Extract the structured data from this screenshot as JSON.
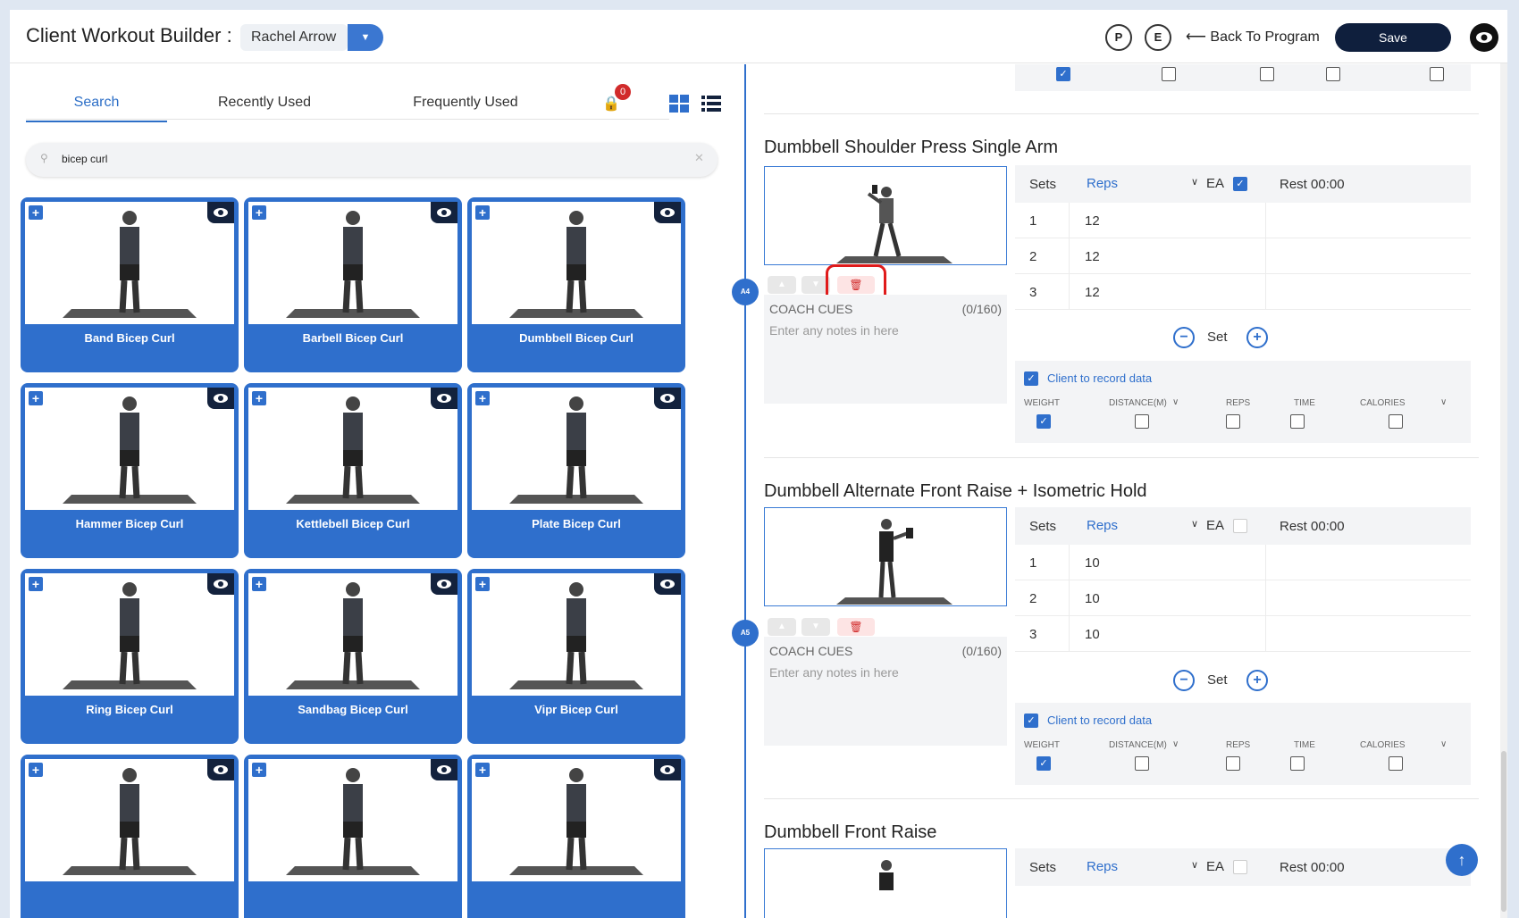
{
  "header": {
    "title": "Client Workout Builder :",
    "client_name": "Rachel Arrow",
    "p_label": "P",
    "e_label": "E",
    "back_label": "Back To Program",
    "save_label": "Save"
  },
  "tabs": {
    "search": "Search",
    "recent": "Recently Used",
    "frequent": "Frequently Used",
    "bag_count": "0"
  },
  "search": {
    "value": "bicep curl"
  },
  "cards": [
    "Band Bicep Curl",
    "Barbell Bicep Curl",
    "Dumbbell Bicep Curl",
    "Hammer Bicep Curl",
    "Kettlebell Bicep Curl",
    "Plate Bicep Curl",
    "Ring Bicep Curl",
    "Sandbag Bicep Curl",
    "Vipr Bicep Curl"
  ],
  "exercises": [
    {
      "badge": "A4",
      "title": "Dumbbell Shoulder Press Single Arm",
      "ea_checked": true,
      "rows": [
        [
          "1",
          "12"
        ],
        [
          "2",
          "12"
        ],
        [
          "3",
          "12"
        ]
      ]
    },
    {
      "badge": "A5",
      "title": "Dumbbell Alternate Front Raise + Isometric Hold",
      "ea_checked": false,
      "rows": [
        [
          "1",
          "10"
        ],
        [
          "2",
          "10"
        ],
        [
          "3",
          "10"
        ]
      ]
    },
    {
      "title": "Dumbbell Front Raise"
    }
  ],
  "table": {
    "sets": "Sets",
    "reps": "Reps",
    "ea": "EA",
    "rest": "Rest 00:00"
  },
  "cues": {
    "label": "COACH CUES",
    "count": "(0/160)",
    "placeholder": "Enter any notes in here"
  },
  "set_label": "Set",
  "record": {
    "label": "Client to record data",
    "weight": "WEIGHT",
    "distance": "DISTANCE(M)",
    "reps": "REPS",
    "time": "TIME",
    "calories": "CALORIES"
  }
}
